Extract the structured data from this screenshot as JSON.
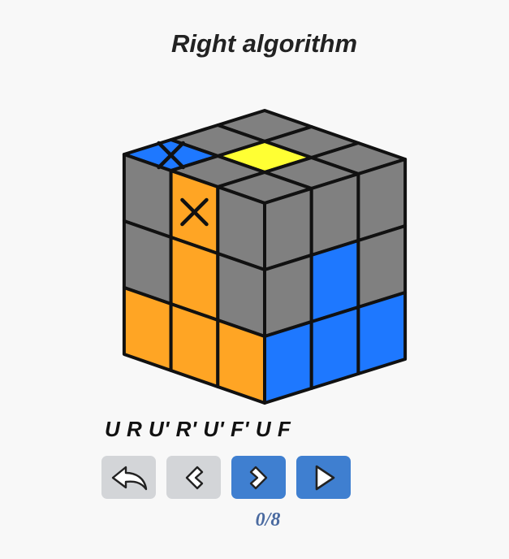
{
  "title": "Right algorithm",
  "algorithm": "U R U' R' U' F' U F",
  "progress": {
    "current": 0,
    "total": 8,
    "label": "0/8"
  },
  "colors": {
    "gray": "#808080",
    "yellow": "#ffff33",
    "blue": "#1e78ff",
    "orange": "#ffa524",
    "button_gray": "#d3d5d8",
    "button_blue": "#3f7fd0",
    "counter_text": "#4a6aa0"
  },
  "cube": {
    "top": [
      [
        "gray",
        "gray",
        "gray"
      ],
      [
        "gray",
        "yellow",
        "gray"
      ],
      [
        "blue",
        "gray",
        "gray"
      ]
    ],
    "top_marks": [
      [
        2,
        0
      ]
    ],
    "left": [
      [
        "gray",
        "orange",
        "gray"
      ],
      [
        "gray",
        "orange",
        "gray"
      ],
      [
        "orange",
        "orange",
        "orange"
      ]
    ],
    "left_marks": [
      [
        0,
        1
      ]
    ],
    "right": [
      [
        "gray",
        "gray",
        "gray"
      ],
      [
        "gray",
        "blue",
        "gray"
      ],
      [
        "blue",
        "blue",
        "blue"
      ]
    ]
  },
  "controls": {
    "reset": "undo-arrow-icon",
    "prev": "chevron-left-icon",
    "next": "chevron-right-icon",
    "play": "play-triangle-icon"
  }
}
